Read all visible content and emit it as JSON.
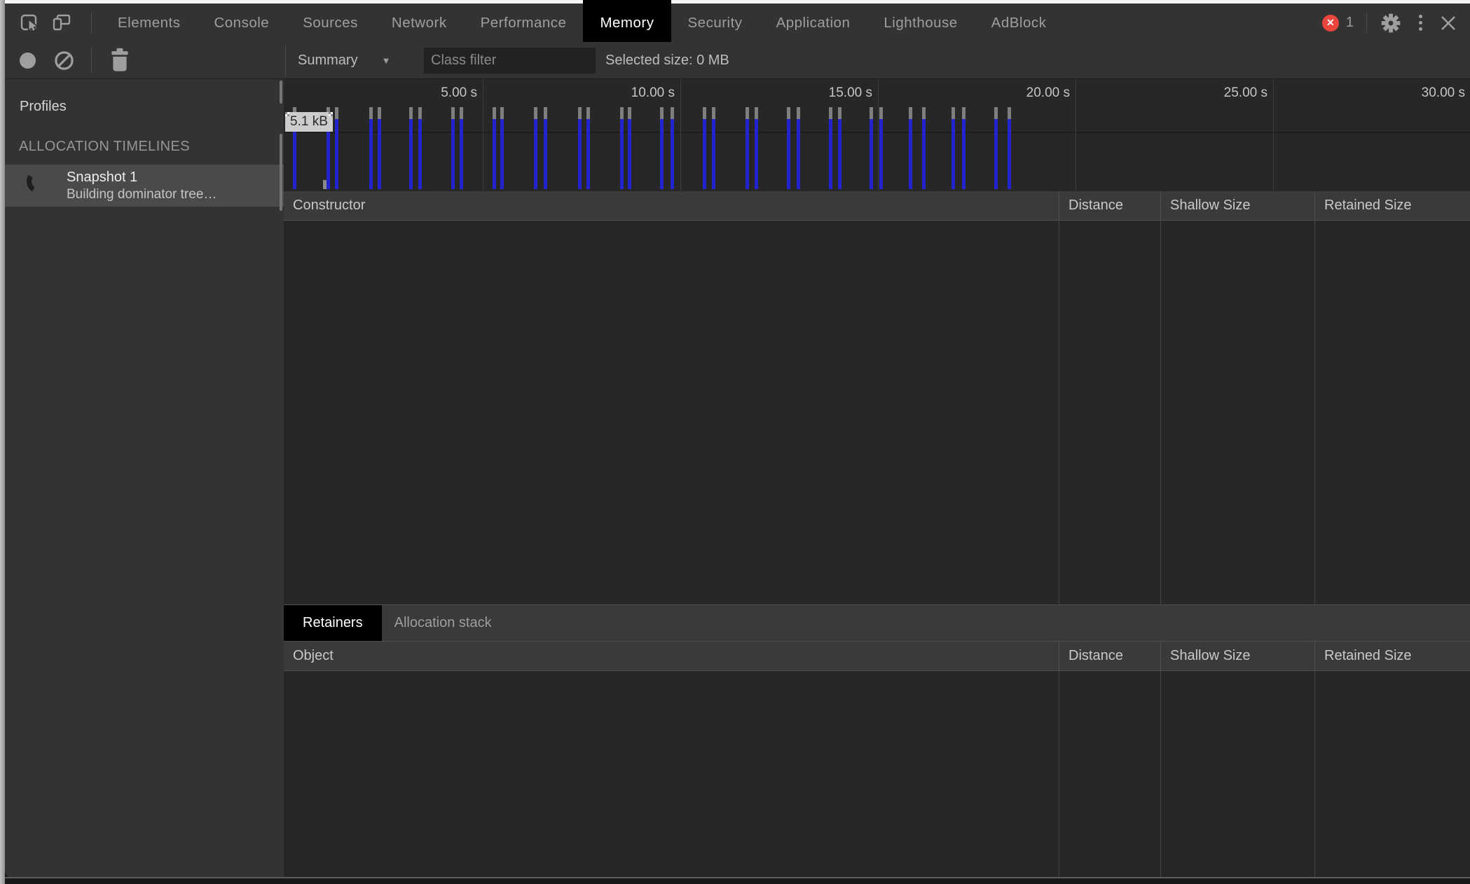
{
  "tabbar": {
    "tabs": [
      "Elements",
      "Console",
      "Sources",
      "Network",
      "Performance",
      "Memory",
      "Security",
      "Application",
      "Lighthouse",
      "AdBlock"
    ],
    "active_tab": "Memory",
    "error_count": "1"
  },
  "toolbar": {
    "summary_label": "Summary",
    "class_filter_placeholder": "Class filter",
    "selected_size_label": "Selected size: 0 MB"
  },
  "sidebar": {
    "profiles_label": "Profiles",
    "section_header": "ALLOCATION TIMELINES",
    "snapshot_title": "Snapshot 1",
    "snapshot_status": "Building dominator tree…"
  },
  "timeline": {
    "max_size_label": "5.1 kB",
    "tick_labels": [
      "5.00 s",
      "10.00 s",
      "15.00 s",
      "20.00 s",
      "25.00 s",
      "30.00 s"
    ],
    "seconds_per_tick": 5,
    "bars": [
      {
        "t": 0.2,
        "kind": "tall"
      },
      {
        "t": 0.96,
        "kind": "stub"
      },
      {
        "t": 1.05,
        "kind": "tall"
      },
      {
        "t": 1.26,
        "kind": "tall"
      },
      {
        "t": 2.13,
        "kind": "tall"
      },
      {
        "t": 2.34,
        "kind": "tall"
      },
      {
        "t": 3.14,
        "kind": "tall"
      },
      {
        "t": 3.37,
        "kind": "tall"
      },
      {
        "t": 4.2,
        "kind": "tall"
      },
      {
        "t": 4.42,
        "kind": "tall"
      },
      {
        "t": 5.25,
        "kind": "tall"
      },
      {
        "t": 5.44,
        "kind": "tall"
      },
      {
        "t": 6.29,
        "kind": "tall"
      },
      {
        "t": 6.54,
        "kind": "tall"
      },
      {
        "t": 7.41,
        "kind": "tall"
      },
      {
        "t": 7.62,
        "kind": "tall"
      },
      {
        "t": 8.48,
        "kind": "tall"
      },
      {
        "t": 8.67,
        "kind": "tall"
      },
      {
        "t": 9.49,
        "kind": "tall"
      },
      {
        "t": 9.75,
        "kind": "tall"
      },
      {
        "t": 10.57,
        "kind": "tall"
      },
      {
        "t": 10.8,
        "kind": "tall"
      },
      {
        "t": 11.65,
        "kind": "tall"
      },
      {
        "t": 11.88,
        "kind": "tall"
      },
      {
        "t": 12.7,
        "kind": "tall"
      },
      {
        "t": 12.94,
        "kind": "tall"
      },
      {
        "t": 13.76,
        "kind": "tall"
      },
      {
        "t": 13.99,
        "kind": "tall"
      },
      {
        "t": 14.79,
        "kind": "tall"
      },
      {
        "t": 15.04,
        "kind": "tall"
      },
      {
        "t": 15.78,
        "kind": "tall"
      },
      {
        "t": 16.12,
        "kind": "tall"
      },
      {
        "t": 16.86,
        "kind": "tall"
      },
      {
        "t": 17.13,
        "kind": "tall"
      },
      {
        "t": 17.94,
        "kind": "tall"
      },
      {
        "t": 18.28,
        "kind": "tall"
      }
    ]
  },
  "grid_top": {
    "columns": [
      "Constructor",
      "Distance",
      "Shallow Size",
      "Retained Size"
    ]
  },
  "retainers_tabs": [
    {
      "label": "Retainers",
      "active": true
    },
    {
      "label": "Allocation stack",
      "active": false
    }
  ],
  "grid_bottom": {
    "columns": [
      "Object",
      "Distance",
      "Shallow Size",
      "Retained Size"
    ]
  },
  "colors": {
    "bar_live": "#2323cf",
    "bar_freed": "#7f7f7f",
    "error_badge": "#e8453c",
    "active_tab_bg": "#000000",
    "max_label_bg": "#cdcdcd"
  }
}
